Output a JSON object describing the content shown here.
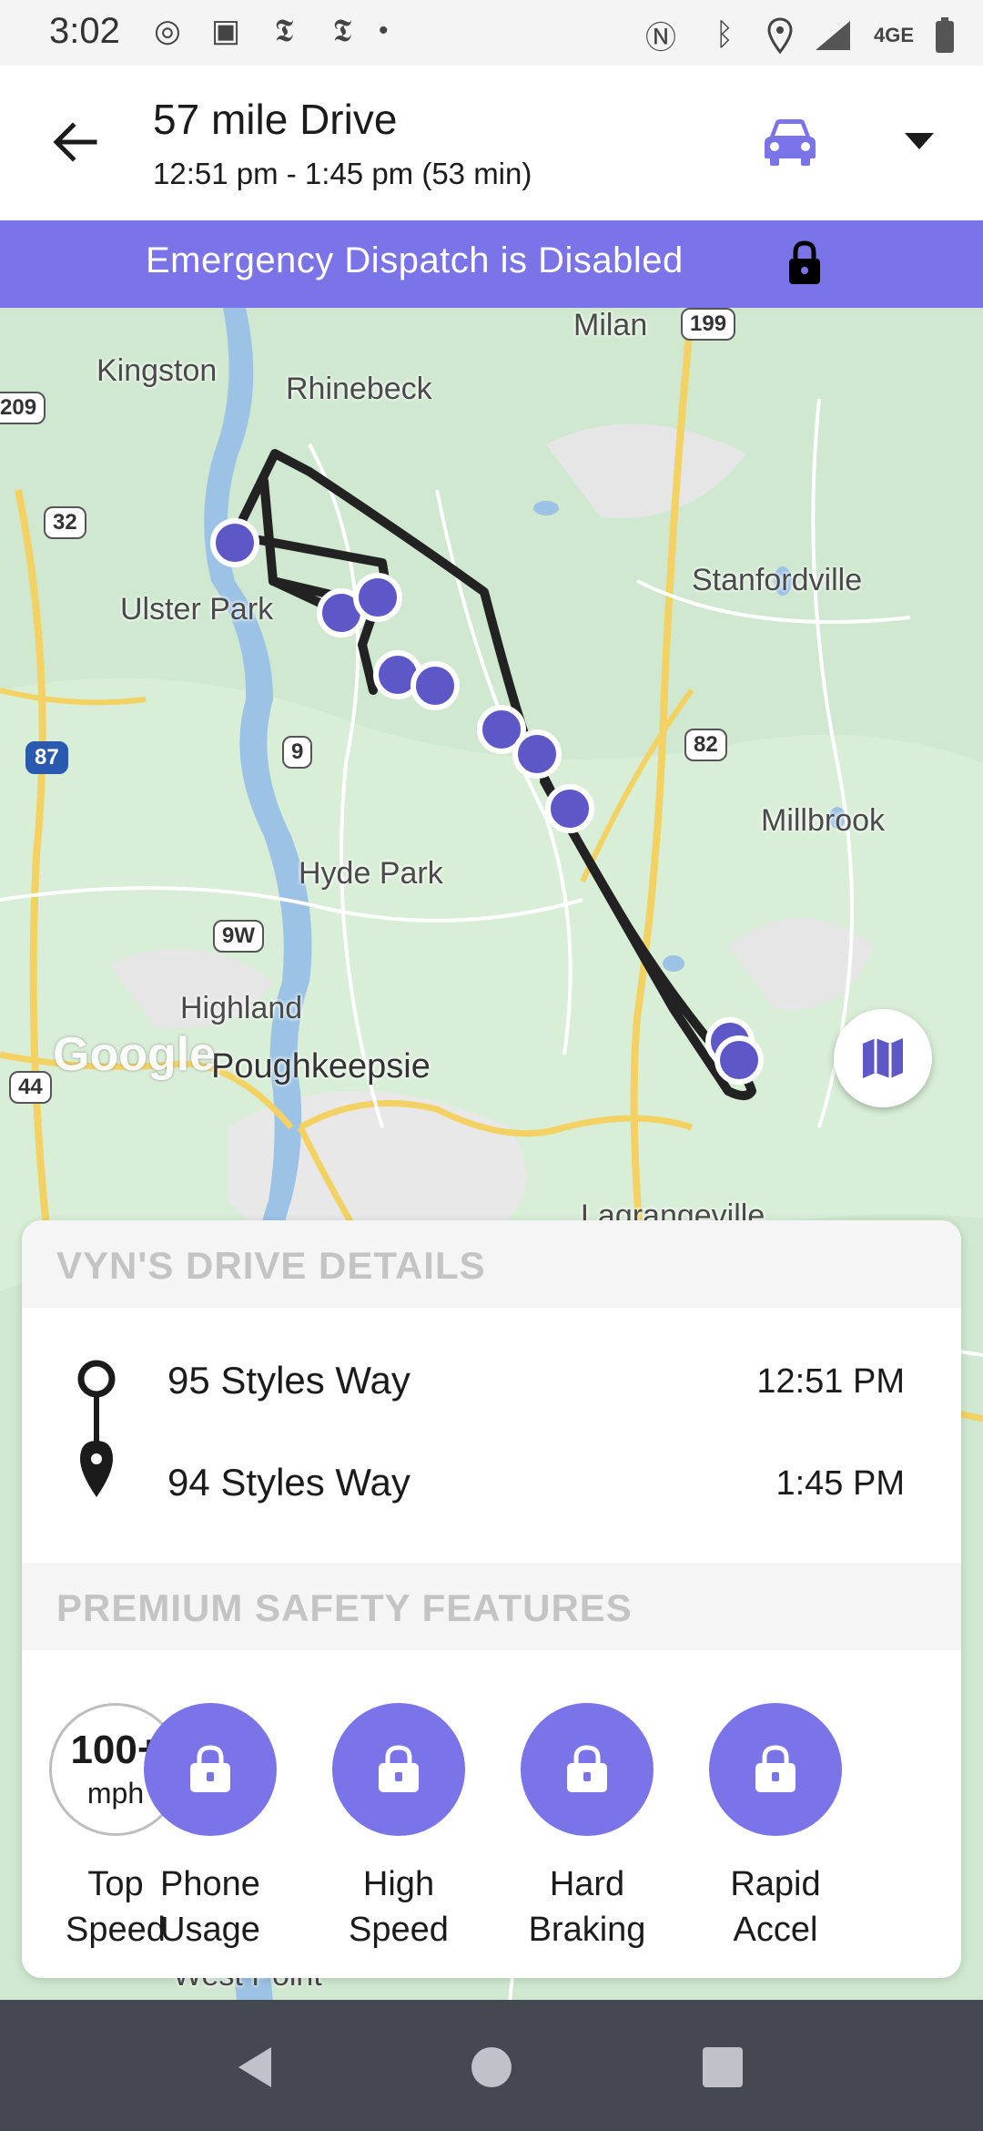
{
  "status_bar": {
    "time": "3:02",
    "left_icons": [
      "podcast-icon",
      "news-icon",
      "nyt-icon",
      "nyt-icon",
      "dot-icon"
    ],
    "right_icons": [
      "nfc-icon",
      "bluetooth-icon",
      "location-icon",
      "signal-icon",
      "battery-icon"
    ],
    "network": "4GE"
  },
  "header": {
    "title": "57 mile Drive",
    "subtitle": "12:51 pm - 1:45 pm (53 min)",
    "vehicle_icon": "car-icon",
    "accent": "#7a74e8"
  },
  "banner": {
    "text": "Emergency Dispatch is Disabled",
    "color": "#7a74e8"
  },
  "map": {
    "labels": {
      "kingston": "Kingston",
      "rhinebeck": "Rhinebeck",
      "milan": "Milan",
      "ulster_park": "Ulster Park",
      "stanfordville": "Stanfordville",
      "millbrook": "Millbrook",
      "hyde_park": "Hyde Park",
      "highland": "Highland",
      "poughkeepsie": "Poughkeepsie",
      "lagrangeville": "Lagrangeville",
      "west_point": "West Point"
    },
    "shields": {
      "r199": "199",
      "r209": "209",
      "r32": "32",
      "i87": "87",
      "r9": "9",
      "r82": "82",
      "r9w": "9W",
      "r44": "44"
    },
    "google": "Google"
  },
  "details": {
    "section_title": "VYN'S DRIVE DETAILS",
    "start_address": "95 Styles Way",
    "start_time": "12:51 PM",
    "end_address": "94 Styles Way",
    "end_time": "1:45 PM"
  },
  "safety": {
    "section_title": "PREMIUM SAFETY FEATURES",
    "top_speed_value": "100+",
    "top_speed_unit": "mph",
    "features": [
      {
        "label_1": "Top",
        "label_2": "Speed"
      },
      {
        "label_1": "Phone",
        "label_2": "Usage"
      },
      {
        "label_1": "High",
        "label_2": "Speed"
      },
      {
        "label_1": "Hard",
        "label_2": "Braking"
      },
      {
        "label_1": "Rapid",
        "label_2": "Accel"
      }
    ]
  }
}
